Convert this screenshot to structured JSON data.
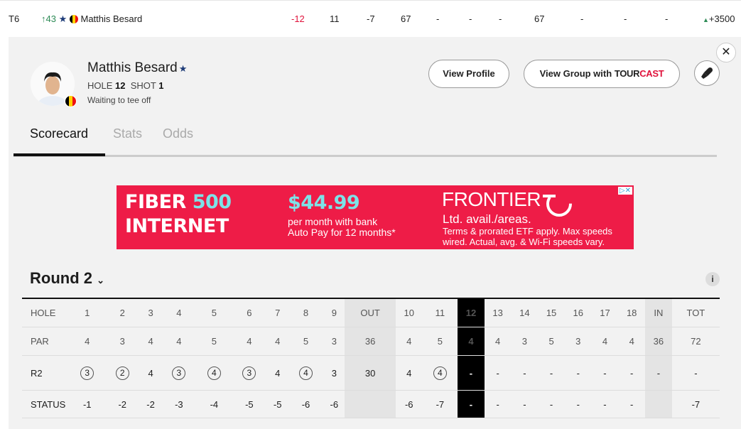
{
  "top_row": {
    "position": "T6",
    "movement": "43",
    "player": "Matthis Besard",
    "today": "-12",
    "thru": "11",
    "total": "-7",
    "r1": "67",
    "r2": "-",
    "r3": "-",
    "r4": "-",
    "strokes": "67",
    "c1": "-",
    "c2": "-",
    "c3": "-",
    "proj": "+3500"
  },
  "player_card": {
    "name": "Matthis Besard",
    "hole_label": "HOLE",
    "hole_value": "12",
    "shot_label": "SHOT",
    "shot_value": "1",
    "status": "Waiting to tee off",
    "buttons": {
      "view_profile": "View Profile",
      "view_group": "View Group with",
      "tour": "TOUR",
      "cast": "CAST"
    },
    "close_icon": "close-icon"
  },
  "tabs": [
    "Scorecard",
    "Stats",
    "Odds"
  ],
  "ad": {
    "line1a": "FIBER ",
    "line1b": "500",
    "line2": "INTERNET",
    "price": "$44.99",
    "price_sub1": "per month with bank",
    "price_sub2": "Auto Pay for 12 months*",
    "brand": "FRONTIER",
    "brand_sub": "Ltd. avail./areas.",
    "fine1": "Terms & prorated ETF apply. Max speeds",
    "fine2": "wired. Actual, avg. & Wi-Fi speeds vary."
  },
  "round_label": "Round 2",
  "scorecard": {
    "holes": [
      "HOLE",
      "1",
      "2",
      "3",
      "4",
      "5",
      "6",
      "7",
      "8",
      "9",
      "OUT",
      "10",
      "11",
      "12",
      "13",
      "14",
      "15",
      "16",
      "17",
      "18",
      "IN",
      "TOT"
    ],
    "par": [
      "PAR",
      "4",
      "3",
      "4",
      "4",
      "5",
      "4",
      "4",
      "5",
      "3",
      "36",
      "4",
      "5",
      "4",
      "4",
      "3",
      "5",
      "3",
      "4",
      "4",
      "36",
      "72"
    ],
    "r2": [
      "R2",
      "3",
      "2",
      "4",
      "3",
      "4",
      "3",
      "4",
      "4",
      "3",
      "30",
      "4",
      "4",
      "-",
      "-",
      "-",
      "-",
      "-",
      "-",
      "-",
      "-",
      "-"
    ],
    "status": [
      "STATUS",
      "-1",
      "-2",
      "-2",
      "-3",
      "-4",
      "-5",
      "-5",
      "-6",
      "-6",
      "",
      "-6",
      "-7",
      "-",
      "-",
      "-",
      "-",
      "-",
      "-",
      "-",
      "",
      "-7"
    ],
    "birdie_holes": [
      1,
      2,
      4,
      5,
      6,
      8,
      12
    ]
  },
  "colors": {
    "accent_red": "#ee1c47",
    "rise_green": "#2e8b57",
    "current_hole": "#000000"
  }
}
